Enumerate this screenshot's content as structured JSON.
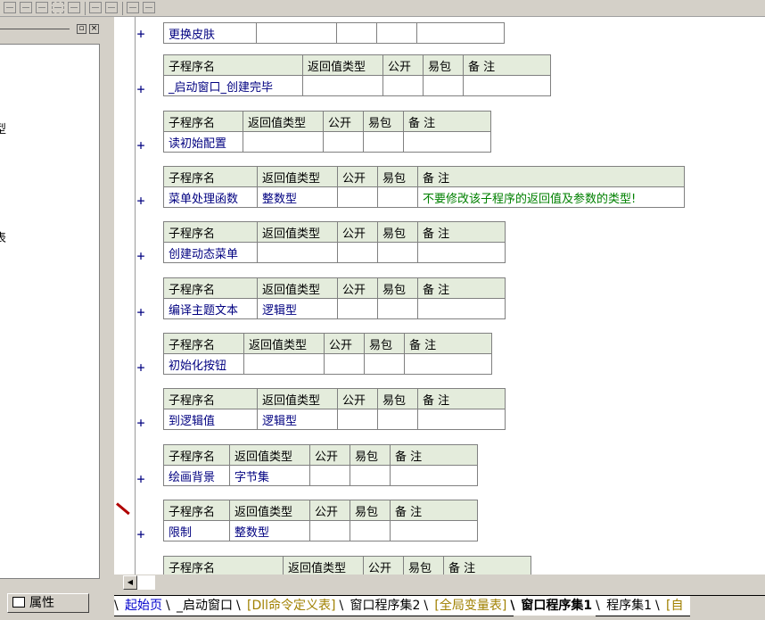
{
  "left_panel": {
    "fragment_1": "型",
    "fragment_2": "表",
    "restore_glyph": "▫",
    "close_glyph": "×"
  },
  "toolbar_icons": [
    "layout-icon",
    "align-icon",
    "bars-icon",
    "columns-icon",
    "width-icon",
    "height-icon",
    "hspace-icon",
    "vspace-icon",
    "center-icon"
  ],
  "editor": {
    "plus": "+",
    "top_row": {
      "name": "更换皮肤"
    },
    "header": {
      "name": "子程序名",
      "ret": "返回值类型",
      "public": "公开",
      "easy": "易包",
      "note": "备 注"
    },
    "subs": [
      {
        "name": "_启动窗口_创建完毕",
        "ret": "",
        "note": ""
      },
      {
        "name": "读初始配置",
        "ret": "",
        "note": ""
      },
      {
        "name": "菜单处理函数",
        "ret": "整数型",
        "note": "不要修改该子程序的返回值及参数的类型!"
      },
      {
        "name": "创建动态菜单",
        "ret": "",
        "note": ""
      },
      {
        "name": "编译主题文本",
        "ret": "逻辑型",
        "note": ""
      },
      {
        "name": "初始化按钮",
        "ret": "",
        "note": ""
      },
      {
        "name": "到逻辑值",
        "ret": "逻辑型",
        "note": ""
      },
      {
        "name": "绘画背景",
        "ret": "字节集",
        "note": ""
      },
      {
        "name": "限制",
        "ret": "整数型",
        "note": ""
      }
    ]
  },
  "bottom": {
    "property_tab": "属性",
    "tabs": [
      {
        "label": "起始页",
        "style": "link"
      },
      {
        "label": "_启动窗口",
        "style": "normal"
      },
      {
        "label": "[Dll命令定义表]",
        "style": "yellow"
      },
      {
        "label": "窗口程序集2",
        "style": "normal"
      },
      {
        "label": "[全局变量表]",
        "style": "yellow"
      },
      {
        "label": "窗口程序集1",
        "style": "active"
      },
      {
        "label": "程序集1",
        "style": "normal"
      },
      {
        "label": "[自",
        "style": "yellow"
      }
    ]
  }
}
